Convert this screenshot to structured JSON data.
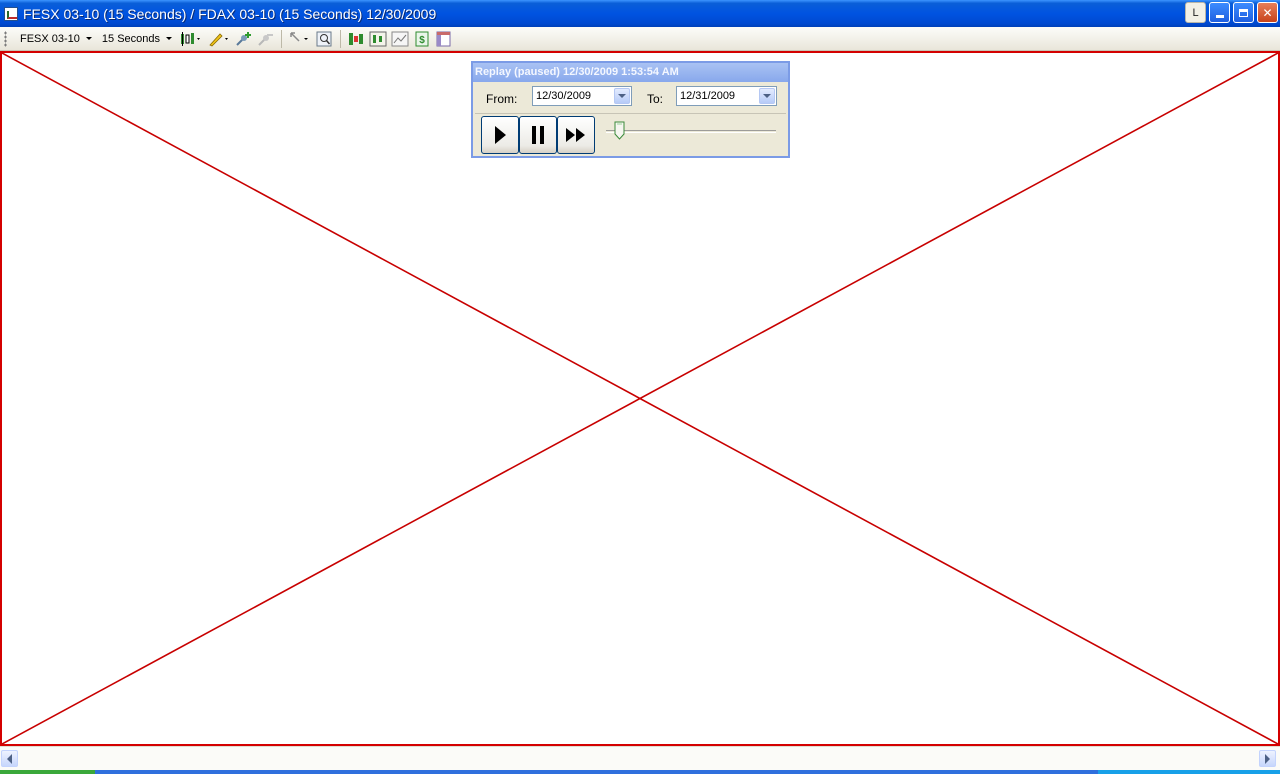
{
  "window": {
    "title": "FESX 03-10 (15 Seconds) / FDAX 03-10 (15 Seconds)  12/30/2009",
    "link_button": "L"
  },
  "toolbar": {
    "instrument": "FESX 03-10",
    "interval": "15 Seconds",
    "icons": [
      "chart-style-icon",
      "drawing-tool-icon",
      "add-indicator-icon",
      "remove-indicator-icon",
      "cursor-select-icon",
      "zoom-icon",
      "data-box-icon",
      "chart-trader-icon",
      "properties-icon",
      "money-icon",
      "template-icon"
    ]
  },
  "replay": {
    "title": "Replay (paused) 12/30/2009 1:53:54 AM",
    "from_label": "From:",
    "from_value": "12/30/2009",
    "to_label": "To:",
    "to_value": "12/31/2009",
    "speed_slider_position": 0.08
  },
  "colors": {
    "chart_border": "#d40000",
    "title_bar": "#0053e1",
    "dialog_border": "#7b9be6"
  }
}
